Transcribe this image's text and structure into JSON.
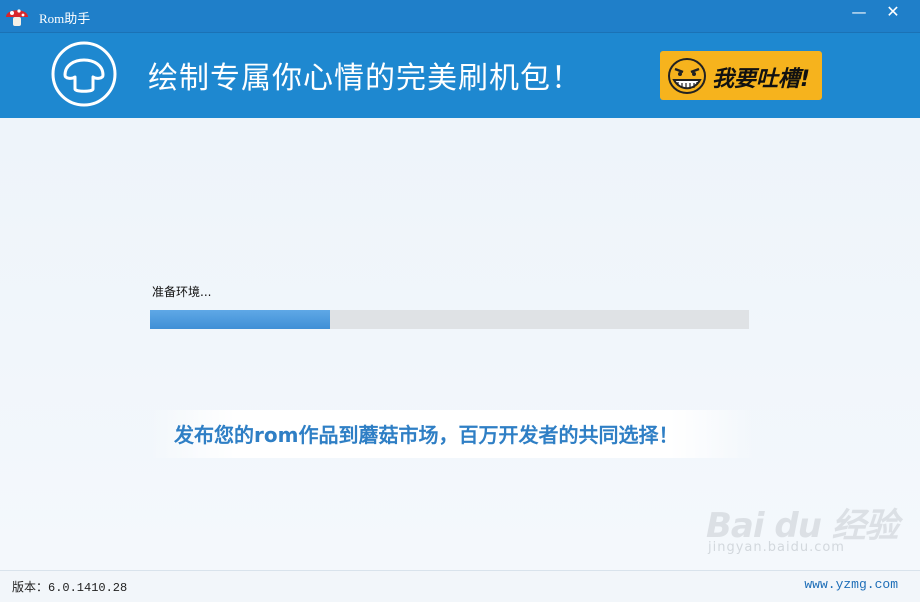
{
  "window": {
    "title": "Rom助手",
    "minimize_glyph": "—",
    "close_glyph": "✕"
  },
  "banner": {
    "slogan": "绘制专属你心情的完美刷机包！",
    "feedback_label": "我要吐槽!"
  },
  "main": {
    "status_text": "准备环境...",
    "progress": 0.3,
    "promo_text": "发布您的rom作品到蘑菇市场，百万开发者的共同选择！"
  },
  "watermark": {
    "brand": "Bai du 经验",
    "sub": "jingyan.baidu.com"
  },
  "footer": {
    "version_label": "版本：6.0.1410.28",
    "site": "www.yzmg.com"
  },
  "colors": {
    "titlebar": "#1f7fc9",
    "banner": "#1e88d0",
    "feedback_bg": "#f6b31d",
    "progress_fill": "#4a98dc",
    "progress_track": "#dfe2e5",
    "promo_text": "#2f7fc5"
  },
  "icons": {
    "app": "mushroom-logo-icon",
    "banner": "mushroom-outline-icon",
    "feedback": "troll-face-icon"
  }
}
